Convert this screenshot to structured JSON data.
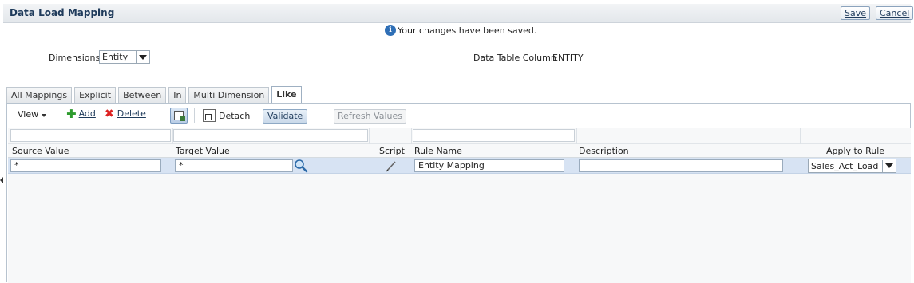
{
  "header": {
    "title": "Data Load Mapping",
    "save_label": "Save",
    "cancel_label": "Cancel"
  },
  "message": {
    "text": "Your changes have been saved."
  },
  "dimensions": {
    "label": "Dimensions",
    "value": "Entity"
  },
  "data_table_column": {
    "label": "Data Table Column",
    "value": "ENTITY"
  },
  "tabs": [
    {
      "label": "All Mappings"
    },
    {
      "label": "Explicit"
    },
    {
      "label": "Between"
    },
    {
      "label": "In"
    },
    {
      "label": "Multi Dimension"
    },
    {
      "label": "Like"
    }
  ],
  "active_tab": "Like",
  "toolbar": {
    "view_label": "View",
    "add_label": "Add",
    "delete_label": "Delete",
    "detach_label": "Detach",
    "validate_label": "Validate",
    "refresh_label": "Refresh Values"
  },
  "table": {
    "columns": {
      "source_value": "Source Value",
      "target_value": "Target Value",
      "script": "Script",
      "rule_name": "Rule Name",
      "description": "Description",
      "apply_to_rule": "Apply to Rule"
    },
    "rows": [
      {
        "source_value": "*",
        "target_value": "*",
        "rule_name": "Entity Mapping",
        "description": "",
        "apply_to_rule": "Sales_Act_Load"
      }
    ]
  },
  "icons": {
    "info": "info-icon",
    "add": "plus-icon",
    "delete": "x-icon",
    "freeze": "freeze-columns-icon",
    "detach": "detach-icon",
    "search": "magnifier-icon",
    "script": "pencil-icon"
  },
  "colors": {
    "selected_row": "#d7e3f3",
    "title_text": "#1f3b5b"
  }
}
